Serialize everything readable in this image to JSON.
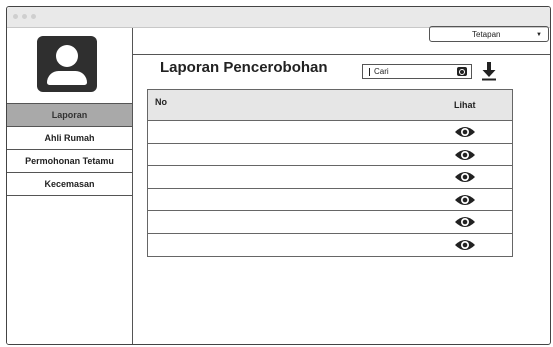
{
  "window": {
    "title": ""
  },
  "sidebar": {
    "items": [
      {
        "label": "Laporan",
        "active": true
      },
      {
        "label": "Ahli Rumah"
      },
      {
        "label": "Permohonan Tetamu"
      },
      {
        "label": "Kecemasan"
      }
    ]
  },
  "header": {
    "dropdown_value": "Tetapan"
  },
  "main": {
    "title": "Laporan Pencerobohan",
    "search": {
      "value": "Cari"
    },
    "table": {
      "columns": [
        "No",
        "Lihat"
      ],
      "rows": [
        {
          "no": "",
          "lihat": "eye-icon"
        },
        {
          "no": "",
          "lihat": "eye-icon"
        },
        {
          "no": "",
          "lihat": "eye-icon"
        },
        {
          "no": "",
          "lihat": "eye-icon"
        },
        {
          "no": "",
          "lihat": "eye-icon"
        },
        {
          "no": "",
          "lihat": "eye-icon"
        }
      ]
    }
  },
  "colors": {
    "active_nav": "#a9a9a9",
    "header_row": "#e6e6e6",
    "icon": "#222222"
  }
}
